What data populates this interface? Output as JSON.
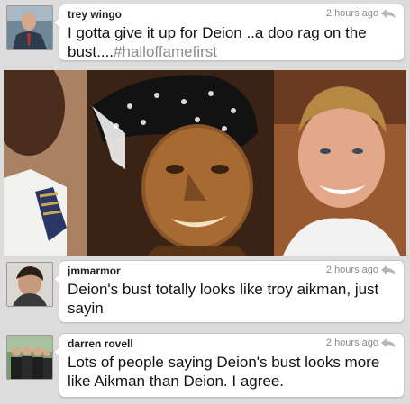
{
  "tweets": [
    {
      "author": "trey wingo",
      "time": "2 hours ago",
      "text": "I gotta give it up for Deion ..a doo rag on the bust....",
      "hashtag": "#halloffamefirst"
    },
    {
      "author": "jmmarmor",
      "time": "2 hours ago",
      "text": "Deion's bust totally looks like troy aikman, just sayin"
    },
    {
      "author": "darren rovell",
      "time": "2 hours ago",
      "text": "Lots of people saying Deion's bust looks more like Aikman than Deion. I agree."
    }
  ],
  "icons": {
    "reply": "reply-arrow-icon"
  },
  "colors": {
    "background": "#dcdcdc",
    "bubble": "#ffffff",
    "hashtag": "#8b8b8b",
    "timestamp": "#8a8a8a"
  }
}
